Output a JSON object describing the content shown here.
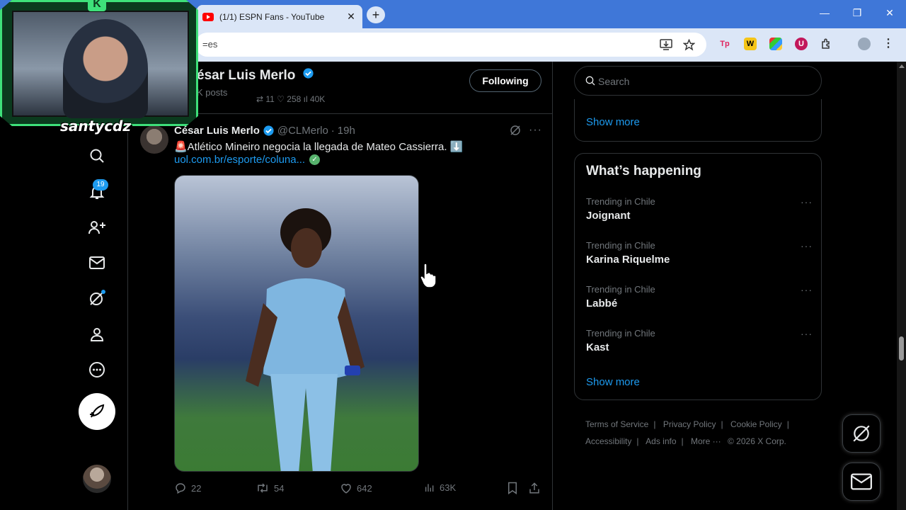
{
  "browser": {
    "tab_title": "(1/1) ESPN Fans - YouTube",
    "tab_close": "✕",
    "new_tab": "+",
    "url_fragment": "=es",
    "window_controls": [
      "—",
      "❐",
      "✕"
    ]
  },
  "webcam": {
    "streamer_name": "santycdz",
    "logo_letter": "K"
  },
  "nav": {
    "notification_count": "19",
    "icons": [
      "search-icon",
      "notifications-icon",
      "follow-icon",
      "messages-icon",
      "grok-icon",
      "profile-icon",
      "more-icon"
    ],
    "post_icon": "feather-icon"
  },
  "header": {
    "account_name": "ésar Luis Merlo",
    "posts_count": "K posts",
    "follow_label": "Following",
    "ghost_stats": "⇄ 11          ♡ 258          ıl 40K"
  },
  "tweet": {
    "author": "César Luis Merlo",
    "handle": "@CLMerlo",
    "dot": "·",
    "time": "19h",
    "text": "🚨Atlético Mineiro negocia la llegada de Mateo Cassierra. ⬇️",
    "link": "uol.com.br/esporte/coluna...",
    "replies": "22",
    "reposts": "54",
    "likes": "642",
    "views": "63K",
    "more": "···"
  },
  "sidebar": {
    "search_placeholder": "Search",
    "show_more_top": "Show more",
    "whats_happening": "What’s happening",
    "trends": [
      {
        "context": "Trending in Chile",
        "name": "Joignant"
      },
      {
        "context": "Trending in Chile",
        "name": "Karina Riquelme"
      },
      {
        "context": "Trending in Chile",
        "name": "Labbé"
      },
      {
        "context": "Trending in Chile",
        "name": "Kast"
      }
    ],
    "trend_more": "···",
    "show_more_bottom": "Show more"
  },
  "footer": {
    "terms": "Terms of Service",
    "privacy": "Privacy Policy",
    "cookie": "Cookie Policy",
    "accessibility": "Accessibility",
    "ads": "Ads info",
    "more": "More ···",
    "copyright": "© 2026 X Corp."
  },
  "colors": {
    "accent": "#1d9bf0",
    "background": "#000000",
    "border": "#2f3336",
    "muted": "#71767b",
    "chrome_blue": "#3f77d8",
    "webcam_green": "#3ee07a"
  }
}
